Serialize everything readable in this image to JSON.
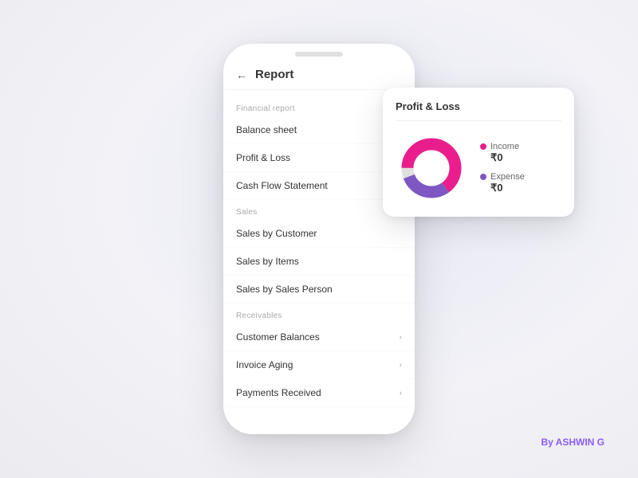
{
  "background": "#f0f0f5",
  "header": {
    "back_icon": "←",
    "title": "Report"
  },
  "sections": [
    {
      "label": "Financial report",
      "items": [
        {
          "text": "Balance sheet",
          "has_chevron": true
        },
        {
          "text": "Profit & Loss",
          "has_chevron": false
        },
        {
          "text": "Cash Flow Statement",
          "has_chevron": false
        }
      ]
    },
    {
      "label": "Sales",
      "items": [
        {
          "text": "Sales by Customer",
          "has_chevron": false
        },
        {
          "text": "Sales by Items",
          "has_chevron": false
        },
        {
          "text": "Sales by Sales Person",
          "has_chevron": false
        }
      ]
    },
    {
      "label": "Receivables",
      "items": [
        {
          "text": "Customer Balances",
          "has_chevron": true
        },
        {
          "text": "Invoice Aging",
          "has_chevron": true
        },
        {
          "text": "Payments Received",
          "has_chevron": true
        }
      ]
    }
  ],
  "pl_card": {
    "title": "Profit & Loss",
    "legend": [
      {
        "label": "Income",
        "value": "₹0",
        "color": "#e91e8c"
      },
      {
        "label": "Expense",
        "value": "₹0",
        "color": "#7e57c2"
      }
    ]
  },
  "watermark": "By ASHWIN G",
  "donut": {
    "income_color": "#e91e8c",
    "expense_color": "#7e57c2",
    "center_color": "#ffffff"
  }
}
